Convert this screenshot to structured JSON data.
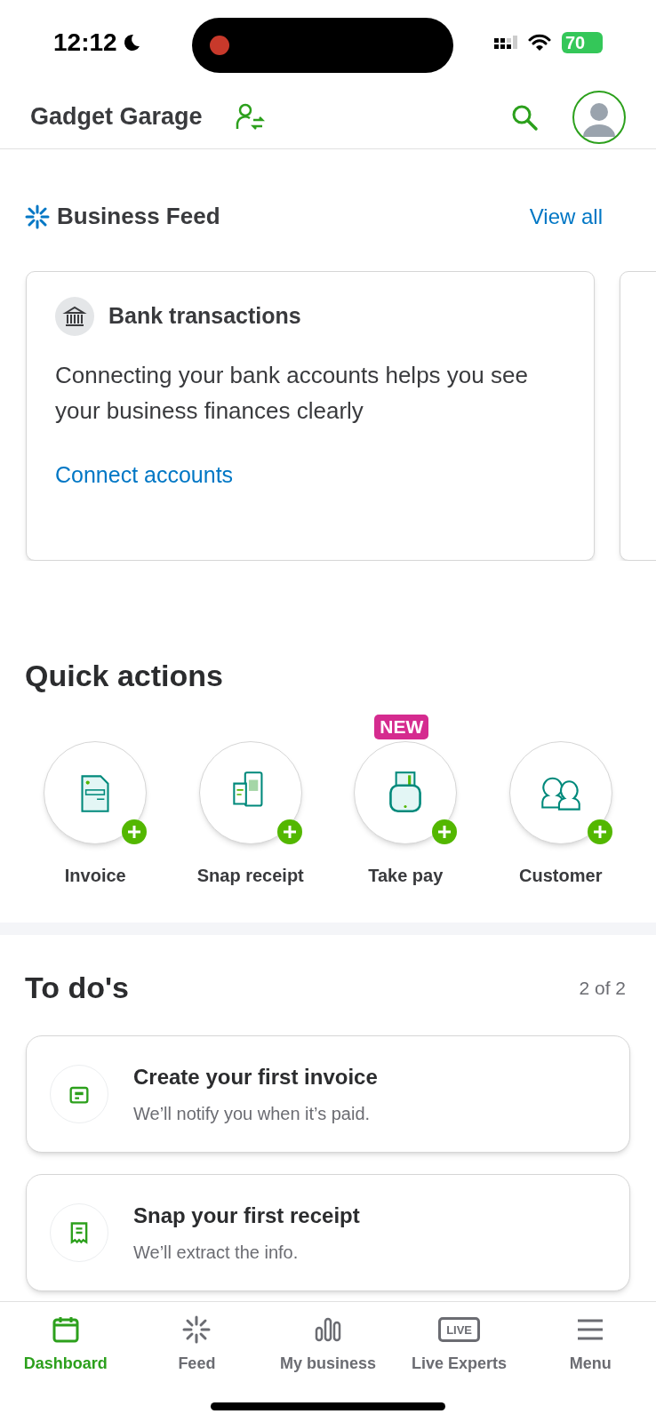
{
  "status_bar": {
    "time": "12:12",
    "battery": "70"
  },
  "header": {
    "company": "Gadget Garage"
  },
  "business_feed": {
    "title": "Business Feed",
    "link": "View all",
    "cards": [
      {
        "title": "Bank transactions",
        "body": "Connecting your bank accounts helps you see your business finances clearly",
        "link": "Connect accounts"
      }
    ]
  },
  "quick_actions": {
    "title": "Quick actions",
    "items": [
      {
        "kind": "invoice",
        "label": "Invoice"
      },
      {
        "kind": "receipt",
        "label": "Snap receipt"
      },
      {
        "kind": "pay",
        "label": "Take pay",
        "badge": "NEW"
      },
      {
        "kind": "customer",
        "label": "Customer"
      }
    ]
  },
  "todos": {
    "title": "To do's",
    "count": "2 of 2",
    "items": [
      {
        "kind": "invoice",
        "title": "Create your first invoice",
        "subtitle": "We’ll notify you when it’s paid."
      },
      {
        "kind": "receipt",
        "title": "Snap your first receipt",
        "subtitle": "We’ll extract the info."
      }
    ]
  },
  "bottom_nav": [
    {
      "kind": "calendar",
      "label": "Dashboard",
      "selected": true
    },
    {
      "kind": "feed",
      "label": "Feed",
      "selected": false
    },
    {
      "kind": "chart",
      "label": "My business",
      "selected": false
    },
    {
      "kind": "live",
      "label": "Live Experts",
      "icon_text": "LIVE",
      "selected": false
    },
    {
      "kind": "menu",
      "label": "Menu",
      "selected": false
    }
  ]
}
